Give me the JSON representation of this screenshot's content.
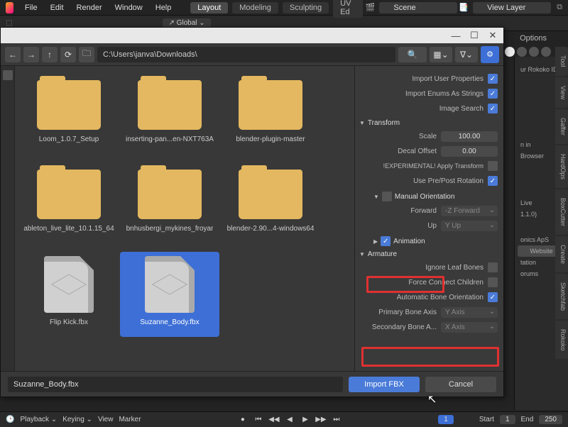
{
  "menubar": {
    "file": "File",
    "edit": "Edit",
    "render": "Render",
    "window": "Window",
    "help": "Help"
  },
  "workspace_tabs": {
    "layout": "Layout",
    "modeling": "Modeling",
    "sculpting": "Sculpting",
    "uved": "UV Ed"
  },
  "top": {
    "scene": "Scene",
    "viewlayer": "View Layer",
    "global": "Global",
    "options": "Options"
  },
  "right_panel": {
    "rokoko": "ur Rokoko ID:",
    "n_in": "n in",
    "browser": "Browser",
    "live": "Live",
    "live_ver": "1.1.0)",
    "aps": "onics ApS",
    "website": "Website",
    "tation": "tation",
    "forums": "orums"
  },
  "vtabs": [
    "Tool",
    "View",
    "Gaffer",
    "HardOps",
    "BoxCutter",
    "Create",
    "Sketchfab",
    "Rokoko"
  ],
  "dialog": {
    "path": "C:\\Users\\janva\\Downloads\\",
    "files": {
      "f0": "Loom_1.0.7_Setup",
      "f1": "inserting-pan...en-NXT763A",
      "f2": "blender-plugin-master",
      "f3": "ableton_live_lite_10.1.15_64",
      "f4": "bnhusbergi_mykines_froyar",
      "f5": "blender-2.90...4-windows64",
      "f6": "Flip Kick.fbx",
      "f7": "Suzanne_Body.fbx"
    },
    "filename": "Suzanne_Body.fbx",
    "import_btn": "Import FBX",
    "cancel_btn": "Cancel"
  },
  "opts": {
    "iup": "Import User Properties",
    "ies": "Import Enums As Strings",
    "img": "Image Search",
    "transform": "Transform",
    "scale": "Scale",
    "scale_v": "100.00",
    "decal": "Decal Offset",
    "decal_v": "0.00",
    "apply": "!EXPERIMENTAL! Apply Transform",
    "prepost": "Use Pre/Post Rotation",
    "manual": "Manual Orientation",
    "forward": "Forward",
    "forward_v": "-Z Forward",
    "up": "Up",
    "up_v": "Y Up",
    "animation": "Animation",
    "armature": "Armature",
    "ignore": "Ignore Leaf Bones",
    "force": "Force Connect Children",
    "auto": "Automatic Bone Orientation",
    "pba": "Primary Bone Axis",
    "pba_v": "Y Axis",
    "sba": "Secondary Bone A...",
    "sba_v": "X Axis"
  },
  "timeline": {
    "playback": "Playback",
    "keying": "Keying",
    "view": "View",
    "marker": "Marker",
    "frame": "1",
    "start_lbl": "Start",
    "start": "1",
    "end_lbl": "End",
    "end": "250"
  }
}
